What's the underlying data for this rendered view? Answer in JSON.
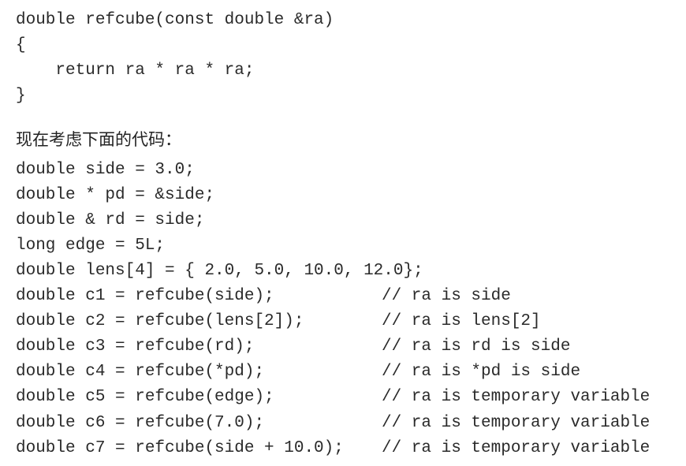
{
  "function_code": [
    "double refcube(const double &ra)",
    "{",
    "    return ra * ra * ra;",
    "}"
  ],
  "intro_text": "现在考虑下面的代码：",
  "example_code": [
    {
      "code": "double side = 3.0;",
      "comment": ""
    },
    {
      "code": "double * pd = &side;",
      "comment": ""
    },
    {
      "code": "double & rd = side;",
      "comment": ""
    },
    {
      "code": "long edge = 5L;",
      "comment": ""
    },
    {
      "code": "double lens[4] = { 2.0, 5.0, 10.0, 12.0};",
      "comment": ""
    },
    {
      "code": "double c1 = refcube(side);",
      "comment": "// ra is side"
    },
    {
      "code": "double c2 = refcube(lens[2]);",
      "comment": "// ra is lens[2]"
    },
    {
      "code": "double c3 = refcube(rd);",
      "comment": "// ra is rd is side"
    },
    {
      "code": "double c4 = refcube(*pd);",
      "comment": "// ra is *pd is side"
    },
    {
      "code": "double c5 = refcube(edge);",
      "comment": "// ra is temporary variable"
    },
    {
      "code": "double c6 = refcube(7.0);",
      "comment": "// ra is temporary variable"
    },
    {
      "code": "double c7 = refcube(side + 10.0);",
      "comment": "// ra is temporary variable"
    }
  ]
}
